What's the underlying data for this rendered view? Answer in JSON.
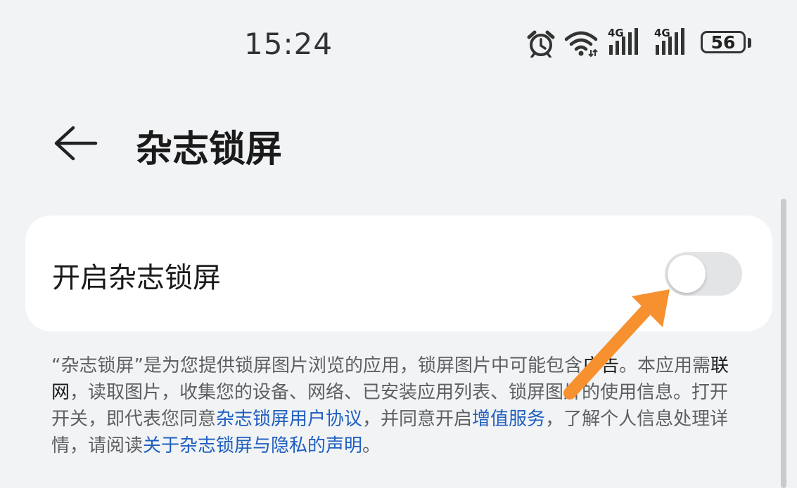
{
  "status_bar": {
    "time": "15:24",
    "icons": [
      "alarm-icon",
      "wifi-icon",
      "signal-4g-icon",
      "signal-4g-icon",
      "battery-icon"
    ],
    "network_label_1": "4G",
    "network_label_2": "4G",
    "battery_level": "56"
  },
  "header": {
    "back_icon": "back-arrow-icon",
    "title": "杂志锁屏"
  },
  "setting": {
    "label": "开启杂志锁屏",
    "toggle_on": false
  },
  "description": {
    "p1": "“杂志锁屏”是为您提供锁屏图片浏览的应用，锁屏图片中可能包含",
    "ad": "广告",
    "p2": "。本应用需",
    "network": "联网",
    "p3": "，读取图片，收集您的设备、网络、已安装应用列表、锁屏图片的使用信息。打开开关，即代表您同意",
    "link_agreement": "杂志锁屏用户协议",
    "p4": "，并同意开启",
    "link_service": "增值服务",
    "p5": "，了解个人信息处理详情，请阅读",
    "link_privacy": "关于杂志锁屏与隐私的声明",
    "p6": "。"
  },
  "colors": {
    "background": "#f1f3f5",
    "card": "#ffffff",
    "link": "#1f5fbf",
    "toggle_off_track": "#e3e4e6",
    "annotation_arrow": "#f7902f"
  }
}
